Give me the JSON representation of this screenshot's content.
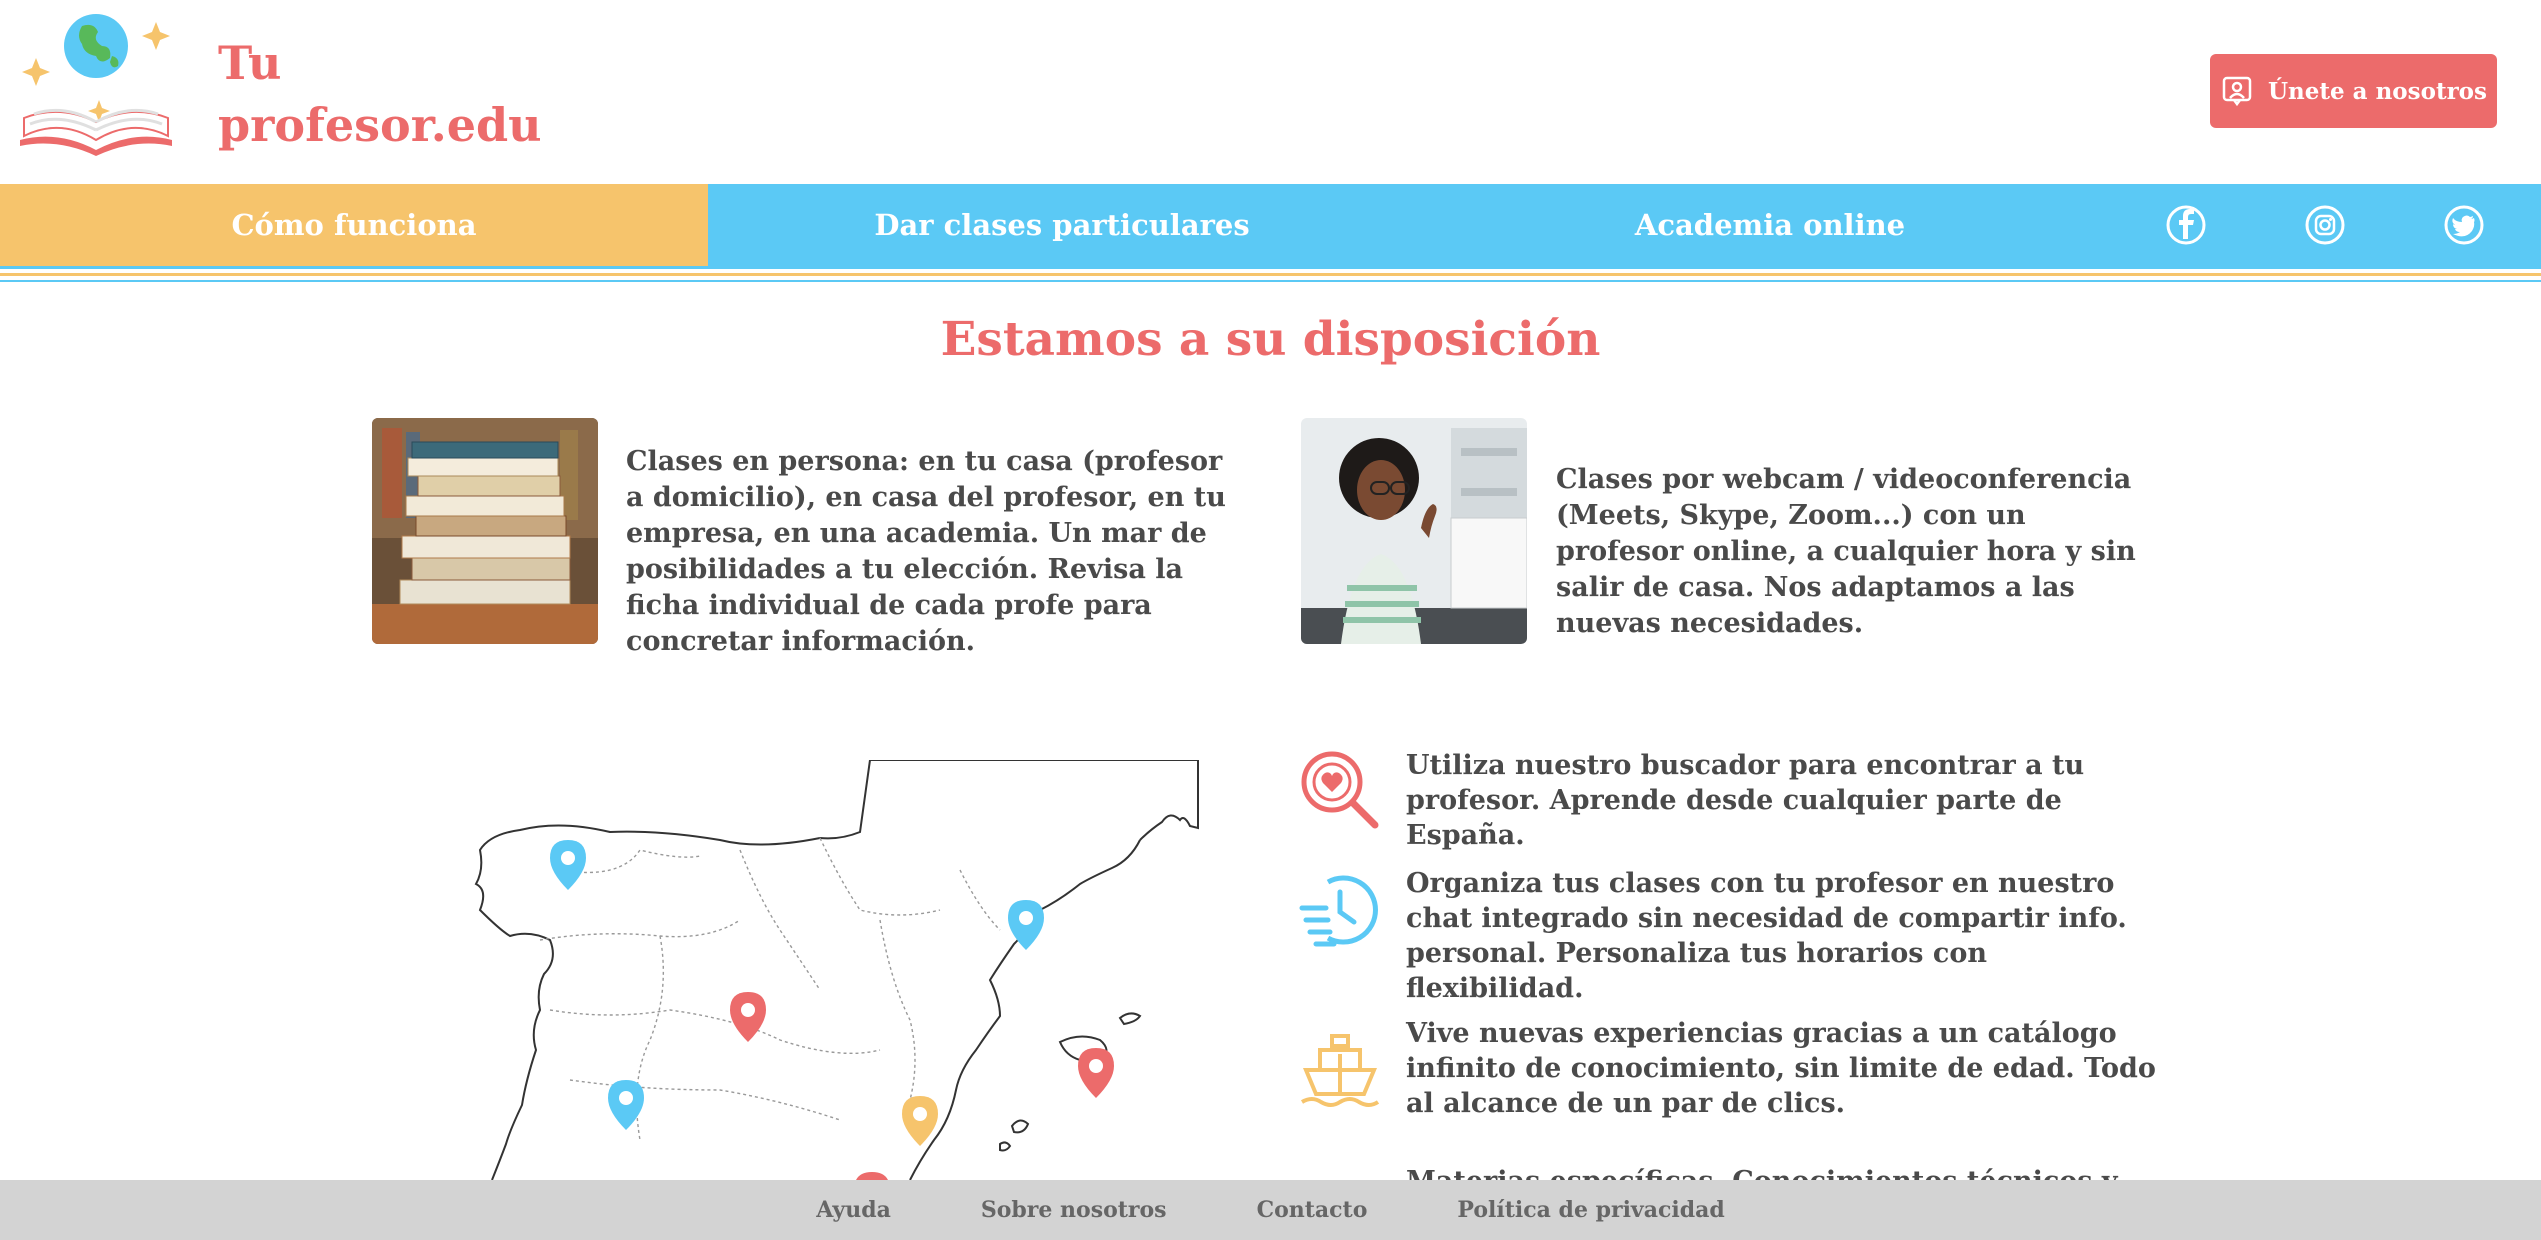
{
  "brand": {
    "line1": "Tu",
    "line2": "profesor.edu"
  },
  "header": {
    "join_label": "Únete a nosotros"
  },
  "nav": {
    "items": [
      {
        "label": "Cómo funciona",
        "active": true
      },
      {
        "label": "Dar clases particulares",
        "active": false
      },
      {
        "label": "Academia online",
        "active": false
      }
    ],
    "social": [
      "facebook-icon",
      "instagram-icon",
      "twitter-icon"
    ]
  },
  "main": {
    "title": "Estamos a su disposición",
    "cards": [
      {
        "text": "Clases en persona: en tu casa (profesor a domicilio), en casa del profesor, en tu empresa, en una academia. Un mar de posibilidades a tu elección. Revisa la ficha individual de cada profe para concretar información."
      },
      {
        "text": "Clases por webcam / videoconferencia (Meets, Skype, Zoom...) con un profesor online, a cualquier hora y sin salir de casa. Nos adaptamos a las nuevas necesidades."
      }
    ],
    "features": [
      {
        "icon": "search-heart-icon",
        "text": "Utiliza nuestro buscador para encontrar a tu profesor. Aprende desde cualquier parte de España."
      },
      {
        "icon": "clock-icon",
        "text": "Organiza tus clases con tu profesor en nuestro chat integrado sin necesidad de compartir info. personal. Personaliza tus horarios con flexibilidad."
      },
      {
        "icon": "ship-icon",
        "text": "Vive nuevas experiencias gracias a un catálogo infinito de conocimiento, sin limite de edad. Todo al alcance de un par de clics."
      },
      {
        "icon": "",
        "text": "Materias específicas. Conocimientos técnicos y profesionales..."
      }
    ]
  },
  "footer": {
    "links": [
      "Ayuda",
      "Sobre nosotros",
      "Contacto",
      "Política de privacidad"
    ]
  },
  "colors": {
    "accent": "#ec6b6b",
    "blue": "#5bc9f5",
    "yellow": "#f6c46c",
    "footer_bg": "#d3d3d3"
  }
}
